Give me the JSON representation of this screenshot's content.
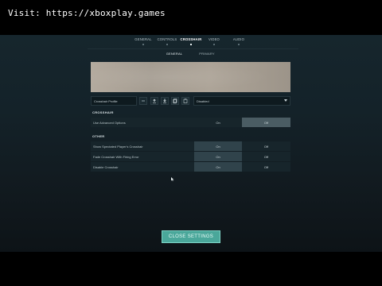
{
  "watermark": "Visit: https://xboxplay.games",
  "nav": {
    "tabs": [
      {
        "label": "GENERAL",
        "active": false
      },
      {
        "label": "CONTROLS",
        "active": false
      },
      {
        "label": "CROSSHAIR",
        "active": true
      },
      {
        "label": "VIDEO",
        "active": false
      },
      {
        "label": "AUDIO",
        "active": false
      }
    ]
  },
  "subnav": {
    "tabs": [
      {
        "label": "GENERAL",
        "active": true
      },
      {
        "label": "PRIMARY",
        "active": false
      }
    ]
  },
  "profile": {
    "name": "Crosshair Profile",
    "select_value": "Disabled",
    "icons": [
      "upload-icon",
      "download-icon",
      "copy-icon",
      "paste-icon"
    ]
  },
  "crosshair_section": {
    "title": "CROSSHAIR",
    "rows": [
      {
        "label": "Use Advanced Options",
        "on": "On",
        "off": "Off",
        "selected": "off"
      }
    ]
  },
  "other_section": {
    "title": "OTHER",
    "rows": [
      {
        "label": "Show Spectated Player's Crosshair",
        "on": "On",
        "off": "Off",
        "selected": "on"
      },
      {
        "label": "Fade Crosshair With Firing Error",
        "on": "On",
        "off": "Off",
        "selected": "on"
      },
      {
        "label": "Disable Crosshair",
        "on": "On",
        "off": "Off",
        "selected": "on"
      }
    ]
  },
  "close_button": "CLOSE SETTINGS",
  "colors": {
    "accent": "#4aa79a",
    "background": "#142229",
    "selected_option": "#4a5c63"
  }
}
